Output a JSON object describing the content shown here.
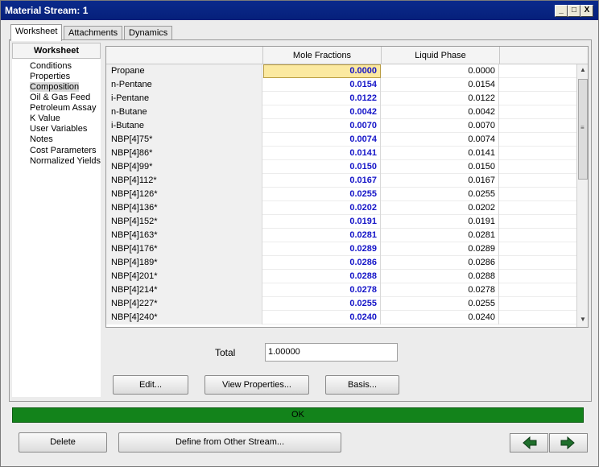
{
  "window": {
    "title": "Material Stream: 1"
  },
  "title_buttons": {
    "minimize": "_",
    "restore": "□",
    "close": "X"
  },
  "tabs": [
    "Worksheet",
    "Attachments",
    "Dynamics"
  ],
  "nav": {
    "header": "Worksheet",
    "items": [
      "Conditions",
      "Properties",
      "Composition",
      "Oil & Gas Feed",
      "Petroleum Assay",
      "K Value",
      "User Variables",
      "Notes",
      "Cost Parameters",
      "Normalized Yields"
    ],
    "selected": "Composition"
  },
  "grid": {
    "columns": [
      "",
      "Mole Fractions",
      "Liquid Phase"
    ],
    "rows": [
      {
        "name": "Propane",
        "mole": "0.0000",
        "liquid": "0.0000"
      },
      {
        "name": "n-Pentane",
        "mole": "0.0154",
        "liquid": "0.0154"
      },
      {
        "name": "i-Pentane",
        "mole": "0.0122",
        "liquid": "0.0122"
      },
      {
        "name": "n-Butane",
        "mole": "0.0042",
        "liquid": "0.0042"
      },
      {
        "name": "i-Butane",
        "mole": "0.0070",
        "liquid": "0.0070"
      },
      {
        "name": "NBP[4]75*",
        "mole": "0.0074",
        "liquid": "0.0074"
      },
      {
        "name": "NBP[4]86*",
        "mole": "0.0141",
        "liquid": "0.0141"
      },
      {
        "name": "NBP[4]99*",
        "mole": "0.0150",
        "liquid": "0.0150"
      },
      {
        "name": "NBP[4]112*",
        "mole": "0.0167",
        "liquid": "0.0167"
      },
      {
        "name": "NBP[4]126*",
        "mole": "0.0255",
        "liquid": "0.0255"
      },
      {
        "name": "NBP[4]136*",
        "mole": "0.0202",
        "liquid": "0.0202"
      },
      {
        "name": "NBP[4]152*",
        "mole": "0.0191",
        "liquid": "0.0191"
      },
      {
        "name": "NBP[4]163*",
        "mole": "0.0281",
        "liquid": "0.0281"
      },
      {
        "name": "NBP[4]176*",
        "mole": "0.0289",
        "liquid": "0.0289"
      },
      {
        "name": "NBP[4]189*",
        "mole": "0.0286",
        "liquid": "0.0286"
      },
      {
        "name": "NBP[4]201*",
        "mole": "0.0288",
        "liquid": "0.0288"
      },
      {
        "name": "NBP[4]214*",
        "mole": "0.0278",
        "liquid": "0.0278"
      },
      {
        "name": "NBP[4]227*",
        "mole": "0.0255",
        "liquid": "0.0255"
      },
      {
        "name": "NBP[4]240*",
        "mole": "0.0240",
        "liquid": "0.0240"
      }
    ],
    "selected_row": "Propane"
  },
  "total": {
    "label": "Total",
    "value": "1.00000"
  },
  "buttons": {
    "edit": "Edit...",
    "view_properties": "View Properties...",
    "basis": "Basis...",
    "delete": "Delete",
    "define_from": "Define from Other Stream..."
  },
  "status": {
    "text": "OK",
    "color": "#13831b"
  },
  "icons": {
    "back": "left-arrow-icon",
    "forward": "right-arrow-icon"
  },
  "colors": {
    "title_bar": "#0a2a8c",
    "mole_text": "#1515c8",
    "selected_cell": "#fbe9a0"
  }
}
